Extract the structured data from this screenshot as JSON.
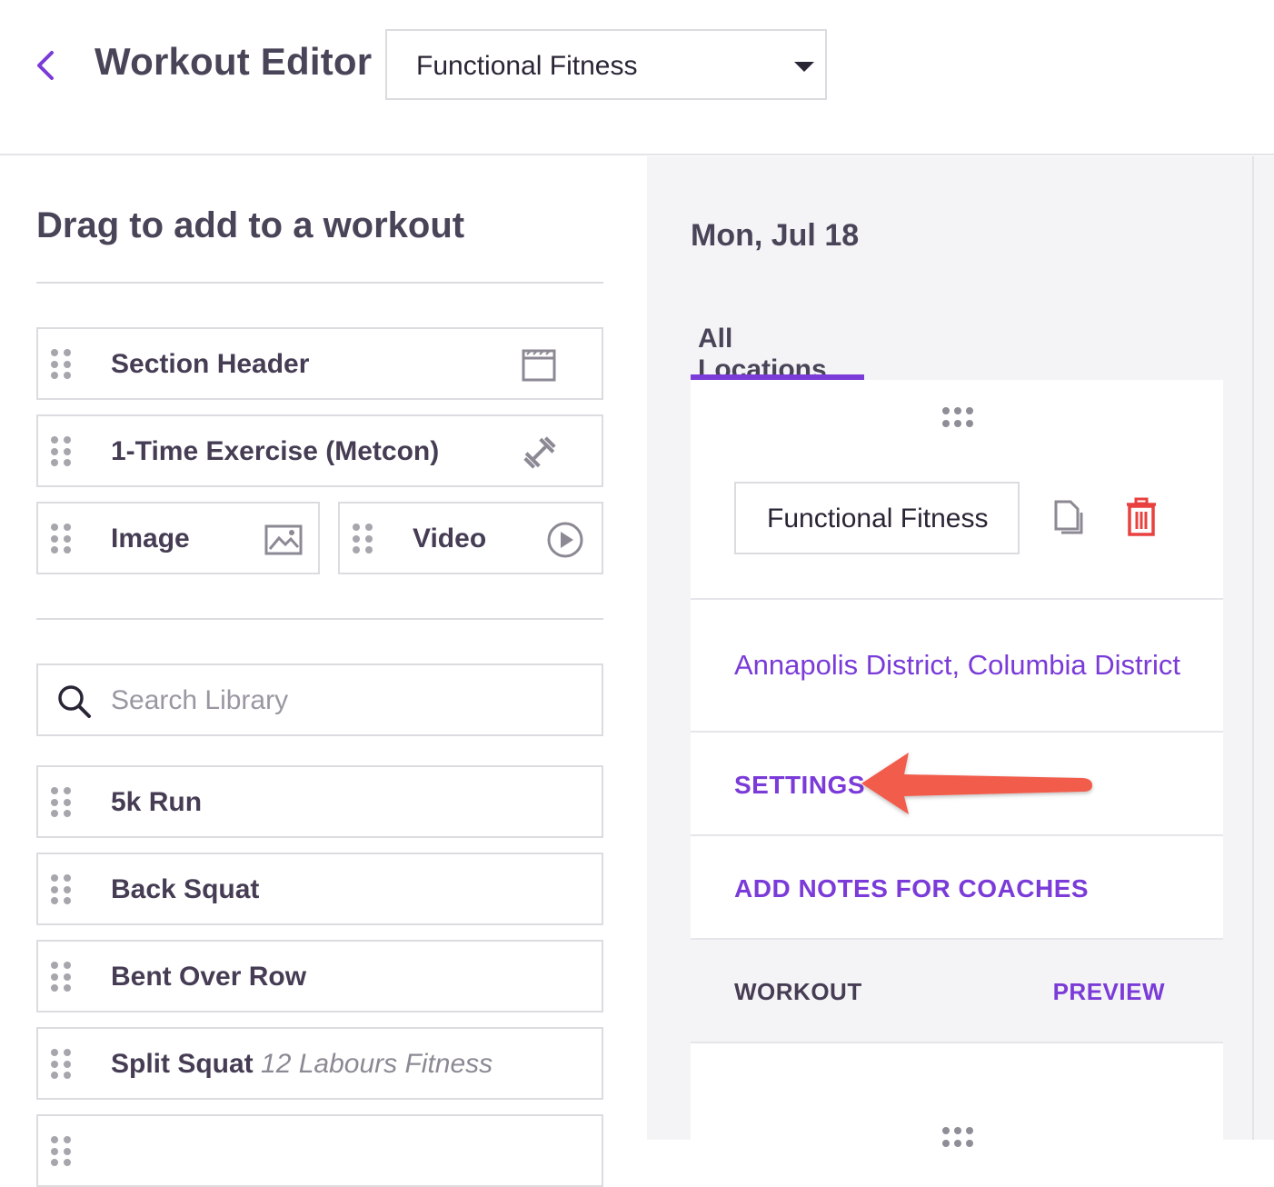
{
  "header": {
    "title": "Workout Editor",
    "program_select": {
      "value": "Functional Fitness"
    }
  },
  "library": {
    "title": "Drag to add to a workout",
    "blocks": {
      "section_header": "Section Header",
      "metcon": "1-Time Exercise (Metcon)",
      "image": "Image",
      "video": "Video"
    },
    "search": {
      "placeholder": "Search Library",
      "value": ""
    },
    "exercises": [
      {
        "name": "5k Run",
        "source": ""
      },
      {
        "name": "Back Squat",
        "source": ""
      },
      {
        "name": "Bent Over Row",
        "source": ""
      },
      {
        "name": "Split Squat",
        "source": "12 Labours Fitness"
      }
    ]
  },
  "editor": {
    "date": "Mon, Jul 18",
    "tab": "All Locations",
    "workout_name": "Functional Fitness",
    "locations": "Annapolis District, Columbia District",
    "settings": "SETTINGS",
    "add_notes": "ADD NOTES FOR COACHES",
    "workout_label": "WORKOUT",
    "preview_label": "PREVIEW"
  },
  "colors": {
    "accent": "#7a3bd8",
    "delete": "#e8413f",
    "annotation_arrow": "#f15b4c",
    "text": "#463d54"
  }
}
